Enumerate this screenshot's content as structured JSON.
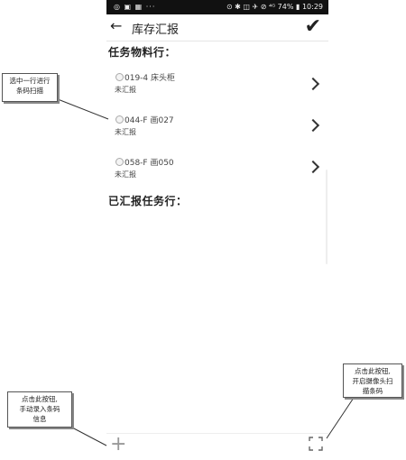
{
  "status_bar": {
    "left_icons": "◎ ▣ ▦  ···",
    "right_text": "⊙ ✱ ◫ ✈ ⊘ ⁴ᴳ 74% ▮ 10:29"
  },
  "header": {
    "back_glyph": "←",
    "title": "库存汇报",
    "confirm_glyph": "✔"
  },
  "sections": {
    "pending_title": "任务物料行：",
    "reported_title": "已汇报任务行："
  },
  "task_rows": [
    {
      "code": "019-4 床头柜",
      "status": "未汇报"
    },
    {
      "code": "044-F 画027",
      "status": "未汇报"
    },
    {
      "code": "058-F 画050",
      "status": "未汇报"
    }
  ],
  "bottom": {
    "add_glyph": "+"
  },
  "annotations": {
    "select_row": [
      "选中一行进行",
      "条码扫描"
    ],
    "manual_entry": [
      "点击此按钮,",
      "手动录入条码",
      "信息"
    ],
    "camera_scan": [
      "点击此按钮,",
      "开启摄像头扫",
      "描条码"
    ]
  },
  "icons": {
    "back": "arrow-left-icon",
    "confirm": "checkmark-icon",
    "add": "plus-icon",
    "scan": "scan-frame-icon",
    "chevron": "chevron-right-icon"
  }
}
